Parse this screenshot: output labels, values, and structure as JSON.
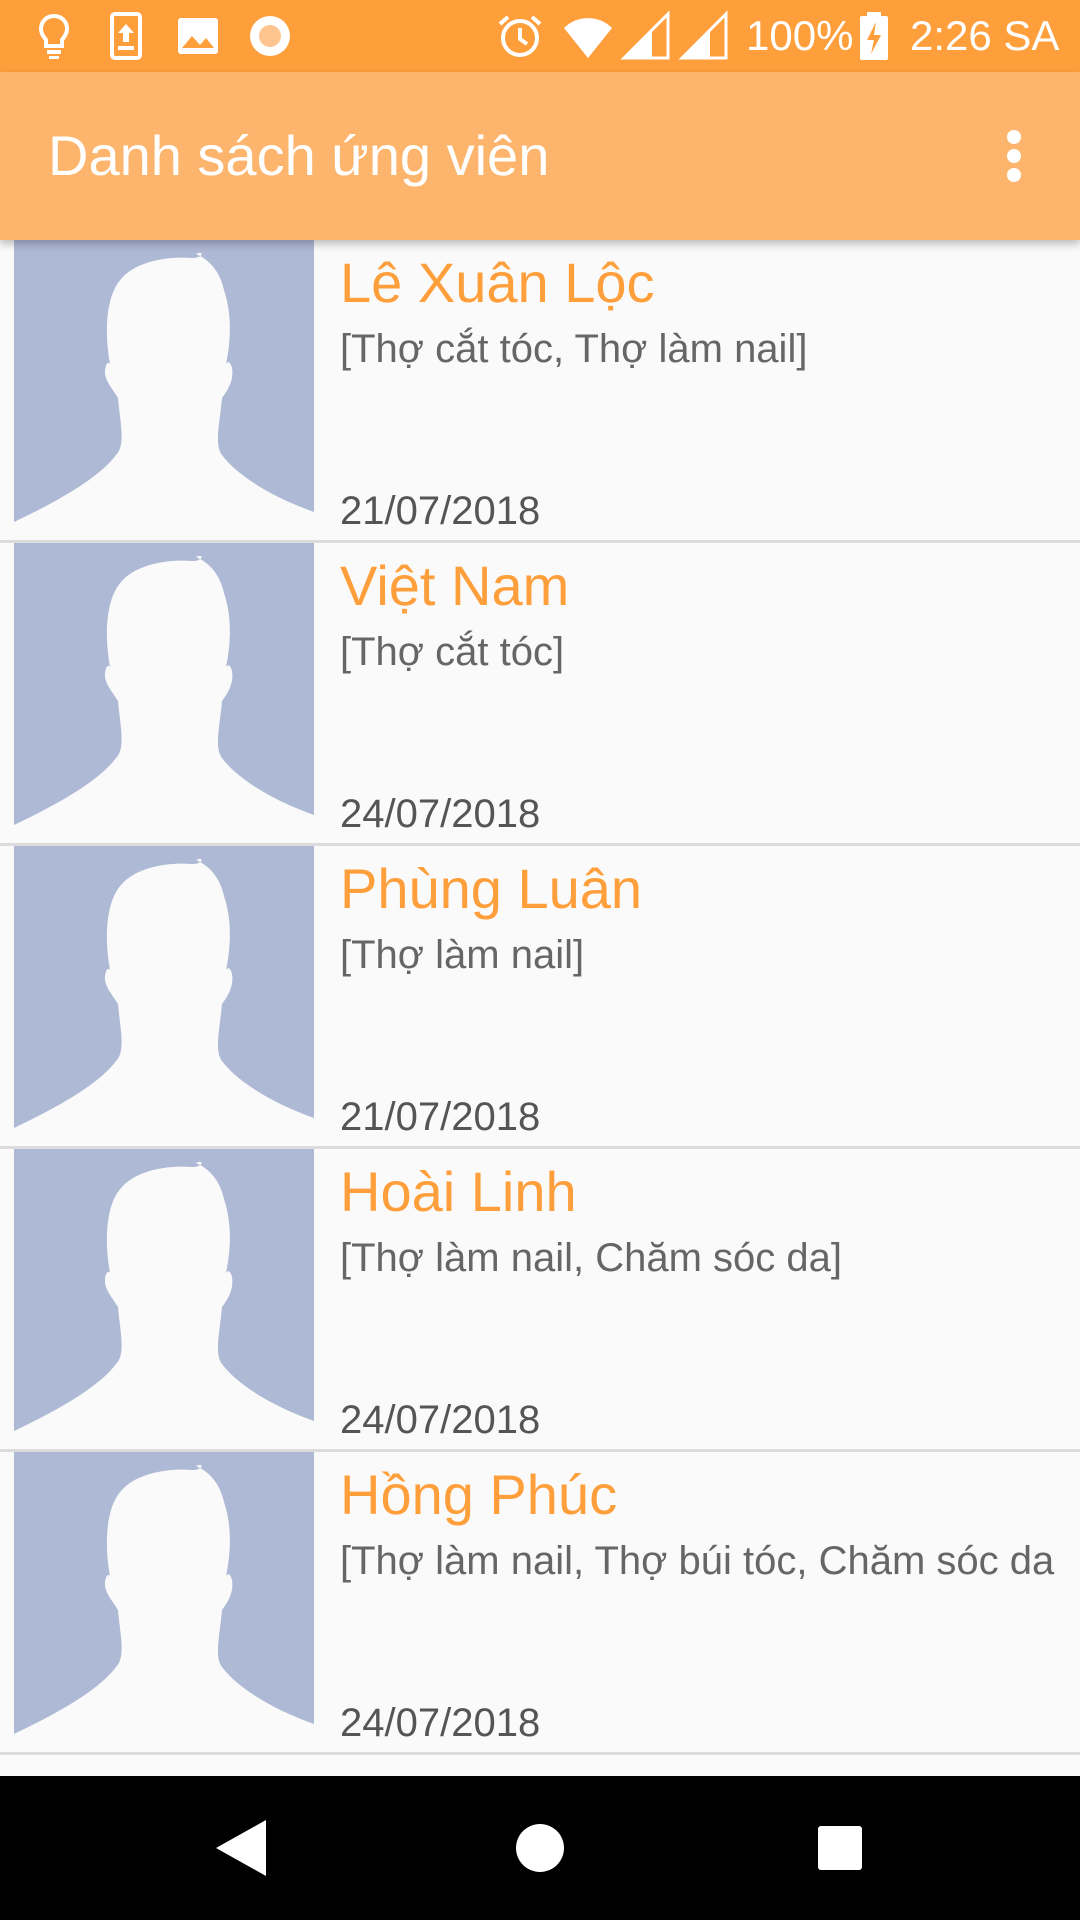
{
  "status_bar": {
    "battery": "100%",
    "time": "2:26 SA",
    "icons": [
      "lightbulb-icon",
      "upload-icon",
      "image-icon",
      "record-icon",
      "alarm-icon",
      "wifi-icon",
      "signal-icon",
      "signal-icon",
      "battery-charging-icon"
    ]
  },
  "app_bar": {
    "title": "Danh sách ứng viên",
    "menu_icon": "more-vert-icon"
  },
  "candidates": [
    {
      "name": "Lê Xuân Lộc",
      "skills": "[Thợ cắt tóc, Thợ làm nail]",
      "date": "21/07/2018"
    },
    {
      "name": "Việt Nam",
      "skills": "[Thợ cắt tóc]",
      "date": "24/07/2018"
    },
    {
      "name": "Phùng Luân",
      "skills": "[Thợ làm nail]",
      "date": "21/07/2018"
    },
    {
      "name": "Hoài Linh",
      "skills": "[Thợ làm nail, Chăm sóc da]",
      "date": "24/07/2018"
    },
    {
      "name": "Hồng Phúc",
      "skills": "[Thợ làm nail, Thợ búi tóc, Chăm sóc da",
      "date": "24/07/2018"
    }
  ],
  "colors": {
    "status_bar": "#ff9f3c",
    "app_bar": "#fdb46c",
    "accent": "#ff9f3c",
    "avatar_bg": "#aeb9d5"
  },
  "nav_bar": {
    "icons": [
      "back-icon",
      "home-icon",
      "recents-icon"
    ]
  }
}
